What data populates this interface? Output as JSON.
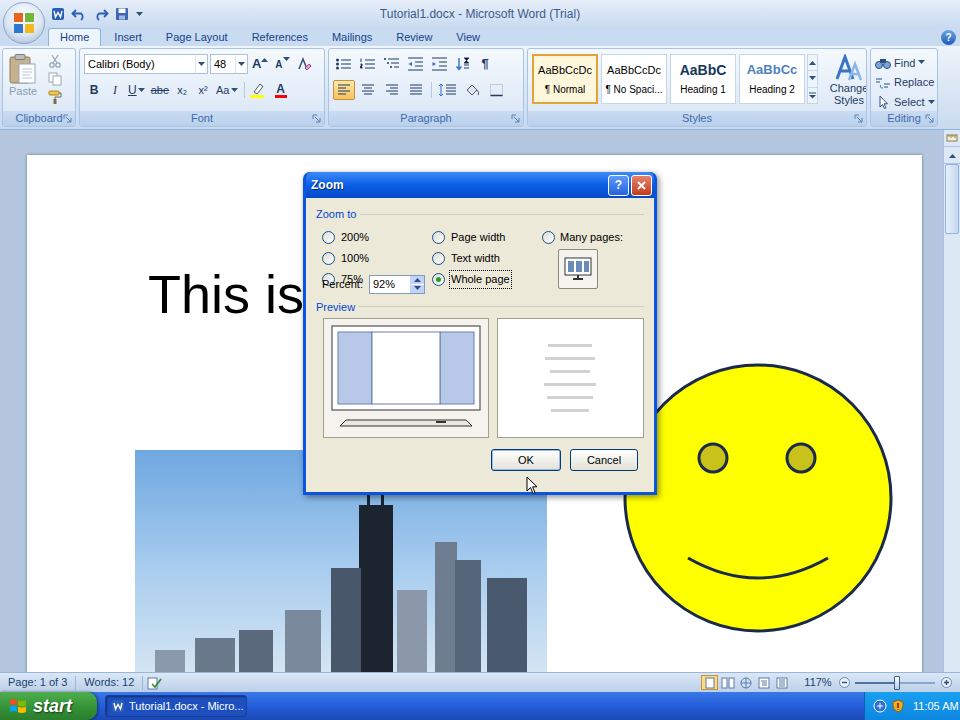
{
  "window": {
    "title": "Tutorial1.docx - Microsoft Word (Trial)",
    "help": "?"
  },
  "tabs": [
    {
      "label": "Home",
      "selected": true
    },
    {
      "label": "Insert",
      "selected": false
    },
    {
      "label": "Page Layout",
      "selected": false
    },
    {
      "label": "References",
      "selected": false
    },
    {
      "label": "Mailings",
      "selected": false
    },
    {
      "label": "Review",
      "selected": false
    },
    {
      "label": "View",
      "selected": false
    }
  ],
  "ribbon": {
    "clipboard": {
      "label": "Clipboard",
      "paste": "Paste"
    },
    "font": {
      "label": "Font",
      "name": "Calibri (Body)",
      "size": "48",
      "grow": "A",
      "shrink": "A",
      "styles": [
        {
          "text": "B",
          "kind": "bold"
        },
        {
          "text": "I",
          "kind": "italic"
        },
        {
          "text": "U",
          "kind": "underline"
        },
        {
          "text": "abe",
          "kind": "strike"
        },
        {
          "text": "x₂",
          "kind": "sub"
        },
        {
          "text": "x²",
          "kind": "super"
        },
        {
          "text": "Aa",
          "kind": "case"
        }
      ],
      "color": "A"
    },
    "paragraph": {
      "label": "Paragraph",
      "marks": "¶",
      "alignments": [
        {
          "kind": "left",
          "selected": true
        },
        {
          "kind": "center",
          "selected": false
        },
        {
          "kind": "right",
          "selected": false
        },
        {
          "kind": "justify",
          "selected": false
        }
      ]
    },
    "styles": {
      "label": "Styles",
      "change": "Change Styles",
      "items": [
        {
          "sample": "AaBbCcDc",
          "label": "¶ Normal",
          "kind": "body",
          "selected": true
        },
        {
          "sample": "AaBbCcDc",
          "label": "¶ No Spaci...",
          "kind": "body",
          "selected": false
        },
        {
          "sample": "AaBbC",
          "label": "Heading 1",
          "kind": "heading1",
          "selected": false
        },
        {
          "sample": "AaBbCc",
          "label": "Heading 2",
          "kind": "heading2",
          "selected": false
        }
      ]
    },
    "editing": {
      "label": "Editing",
      "items": [
        "Find",
        "Replace",
        "Select"
      ]
    }
  },
  "document": {
    "text": "This is"
  },
  "dialog": {
    "title": "Zoom",
    "help": "?",
    "zoom_to": "Zoom to",
    "options": [
      {
        "label": "200%",
        "selected": false
      },
      {
        "label": "Page width",
        "selected": false
      },
      {
        "label": "100%",
        "selected": false
      },
      {
        "label": "Text width",
        "selected": false
      },
      {
        "label": "75%",
        "selected": false
      },
      {
        "label": "Whole page",
        "selected": true
      }
    ],
    "many_pages": {
      "label": "Many pages:",
      "selected": false
    },
    "percent_label": "Percent:",
    "percent": "92%",
    "preview": "Preview",
    "buttons": [
      "OK",
      "Cancel"
    ]
  },
  "status_bar": {
    "page": "Page: 1 of 3",
    "words": "Words: 12",
    "zoom": "117%",
    "zoom_level": 0.53
  },
  "taskbar": {
    "start": "start",
    "tasks": [
      {
        "label": "Tutorial1.docx - Micro...",
        "selected": true
      }
    ],
    "clock": "11:05 AM"
  }
}
